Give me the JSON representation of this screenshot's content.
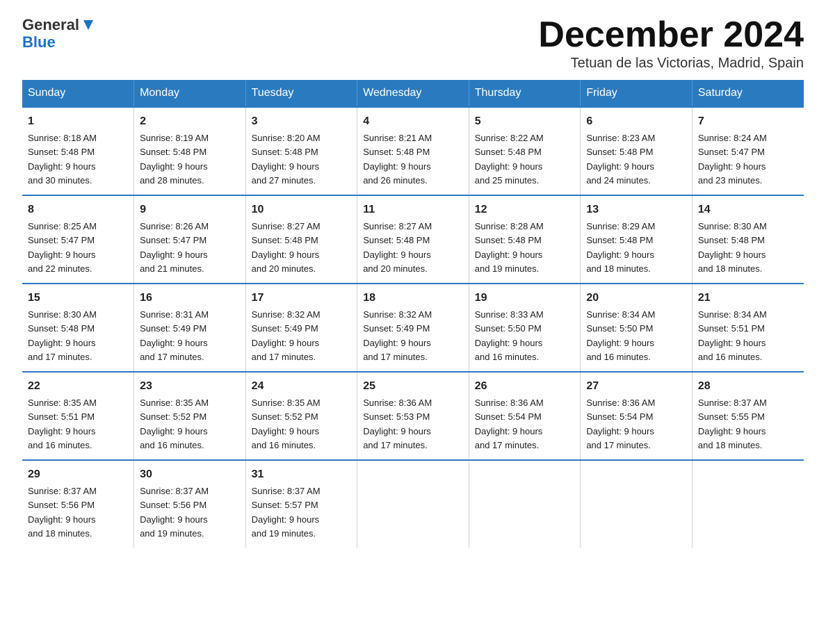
{
  "header": {
    "logo_general": "General",
    "logo_blue": "Blue",
    "month_title": "December 2024",
    "location": "Tetuan de las Victorias, Madrid, Spain"
  },
  "days_of_week": [
    "Sunday",
    "Monday",
    "Tuesday",
    "Wednesday",
    "Thursday",
    "Friday",
    "Saturday"
  ],
  "weeks": [
    [
      {
        "day": "1",
        "sunrise": "8:18 AM",
        "sunset": "5:48 PM",
        "daylight": "9 hours and 30 minutes."
      },
      {
        "day": "2",
        "sunrise": "8:19 AM",
        "sunset": "5:48 PM",
        "daylight": "9 hours and 28 minutes."
      },
      {
        "day": "3",
        "sunrise": "8:20 AM",
        "sunset": "5:48 PM",
        "daylight": "9 hours and 27 minutes."
      },
      {
        "day": "4",
        "sunrise": "8:21 AM",
        "sunset": "5:48 PM",
        "daylight": "9 hours and 26 minutes."
      },
      {
        "day": "5",
        "sunrise": "8:22 AM",
        "sunset": "5:48 PM",
        "daylight": "9 hours and 25 minutes."
      },
      {
        "day": "6",
        "sunrise": "8:23 AM",
        "sunset": "5:48 PM",
        "daylight": "9 hours and 24 minutes."
      },
      {
        "day": "7",
        "sunrise": "8:24 AM",
        "sunset": "5:47 PM",
        "daylight": "9 hours and 23 minutes."
      }
    ],
    [
      {
        "day": "8",
        "sunrise": "8:25 AM",
        "sunset": "5:47 PM",
        "daylight": "9 hours and 22 minutes."
      },
      {
        "day": "9",
        "sunrise": "8:26 AM",
        "sunset": "5:47 PM",
        "daylight": "9 hours and 21 minutes."
      },
      {
        "day": "10",
        "sunrise": "8:27 AM",
        "sunset": "5:48 PM",
        "daylight": "9 hours and 20 minutes."
      },
      {
        "day": "11",
        "sunrise": "8:27 AM",
        "sunset": "5:48 PM",
        "daylight": "9 hours and 20 minutes."
      },
      {
        "day": "12",
        "sunrise": "8:28 AM",
        "sunset": "5:48 PM",
        "daylight": "9 hours and 19 minutes."
      },
      {
        "day": "13",
        "sunrise": "8:29 AM",
        "sunset": "5:48 PM",
        "daylight": "9 hours and 18 minutes."
      },
      {
        "day": "14",
        "sunrise": "8:30 AM",
        "sunset": "5:48 PM",
        "daylight": "9 hours and 18 minutes."
      }
    ],
    [
      {
        "day": "15",
        "sunrise": "8:30 AM",
        "sunset": "5:48 PM",
        "daylight": "9 hours and 17 minutes."
      },
      {
        "day": "16",
        "sunrise": "8:31 AM",
        "sunset": "5:49 PM",
        "daylight": "9 hours and 17 minutes."
      },
      {
        "day": "17",
        "sunrise": "8:32 AM",
        "sunset": "5:49 PM",
        "daylight": "9 hours and 17 minutes."
      },
      {
        "day": "18",
        "sunrise": "8:32 AM",
        "sunset": "5:49 PM",
        "daylight": "9 hours and 17 minutes."
      },
      {
        "day": "19",
        "sunrise": "8:33 AM",
        "sunset": "5:50 PM",
        "daylight": "9 hours and 16 minutes."
      },
      {
        "day": "20",
        "sunrise": "8:34 AM",
        "sunset": "5:50 PM",
        "daylight": "9 hours and 16 minutes."
      },
      {
        "day": "21",
        "sunrise": "8:34 AM",
        "sunset": "5:51 PM",
        "daylight": "9 hours and 16 minutes."
      }
    ],
    [
      {
        "day": "22",
        "sunrise": "8:35 AM",
        "sunset": "5:51 PM",
        "daylight": "9 hours and 16 minutes."
      },
      {
        "day": "23",
        "sunrise": "8:35 AM",
        "sunset": "5:52 PM",
        "daylight": "9 hours and 16 minutes."
      },
      {
        "day": "24",
        "sunrise": "8:35 AM",
        "sunset": "5:52 PM",
        "daylight": "9 hours and 16 minutes."
      },
      {
        "day": "25",
        "sunrise": "8:36 AM",
        "sunset": "5:53 PM",
        "daylight": "9 hours and 17 minutes."
      },
      {
        "day": "26",
        "sunrise": "8:36 AM",
        "sunset": "5:54 PM",
        "daylight": "9 hours and 17 minutes."
      },
      {
        "day": "27",
        "sunrise": "8:36 AM",
        "sunset": "5:54 PM",
        "daylight": "9 hours and 17 minutes."
      },
      {
        "day": "28",
        "sunrise": "8:37 AM",
        "sunset": "5:55 PM",
        "daylight": "9 hours and 18 minutes."
      }
    ],
    [
      {
        "day": "29",
        "sunrise": "8:37 AM",
        "sunset": "5:56 PM",
        "daylight": "9 hours and 18 minutes."
      },
      {
        "day": "30",
        "sunrise": "8:37 AM",
        "sunset": "5:56 PM",
        "daylight": "9 hours and 19 minutes."
      },
      {
        "day": "31",
        "sunrise": "8:37 AM",
        "sunset": "5:57 PM",
        "daylight": "9 hours and 19 minutes."
      },
      null,
      null,
      null,
      null
    ]
  ],
  "labels": {
    "sunrise": "Sunrise:",
    "sunset": "Sunset:",
    "daylight": "Daylight:"
  }
}
